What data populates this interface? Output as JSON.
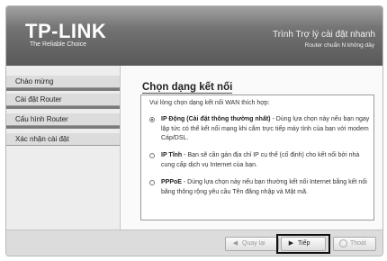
{
  "header": {
    "logo": "TP-LINK",
    "tagline": "The Reliable Choice",
    "title": "Trình Trợ lý cài đặt nhanh",
    "subtitle": "Router chuẩn N không dây"
  },
  "sidebar": {
    "items": [
      {
        "label": "Chào mừng"
      },
      {
        "label": "Cài đặt Router"
      },
      {
        "label": "Cấu hình Router"
      },
      {
        "label": "Xác nhận cài đặt"
      }
    ]
  },
  "content": {
    "title": "Chọn dạng kết nối",
    "intro": "Vui lòng chọn dạng kết nối WAN thích hợp:",
    "options": [
      {
        "name": "IP Động (Cài đặt thông thường nhất)",
        "desc": " - Dùng lựa chọn này nếu bạn ngay lập tức có thể kết nối mạng khi cắm trực tiếp máy tính của bạn với modem Cáp/DSL.",
        "checked": true
      },
      {
        "name": "IP Tĩnh",
        "desc": " - Bạn sẽ cần gán địa chỉ IP cụ thể (cố định) cho kết nối bởi nhà cung cấp dịch vụ Internet của bạn.",
        "checked": false
      },
      {
        "name": "PPPoE",
        "desc": " - Dùng lựa chọn này nếu bạn thường kết nối Internet bằng kết nối băng thông rộng yêu cầu Tên đăng nhập và Mật mã.",
        "checked": false
      }
    ]
  },
  "footer": {
    "back_label": "Quay lại",
    "next_label": "Tiếp",
    "exit_label": "Thoát"
  }
}
